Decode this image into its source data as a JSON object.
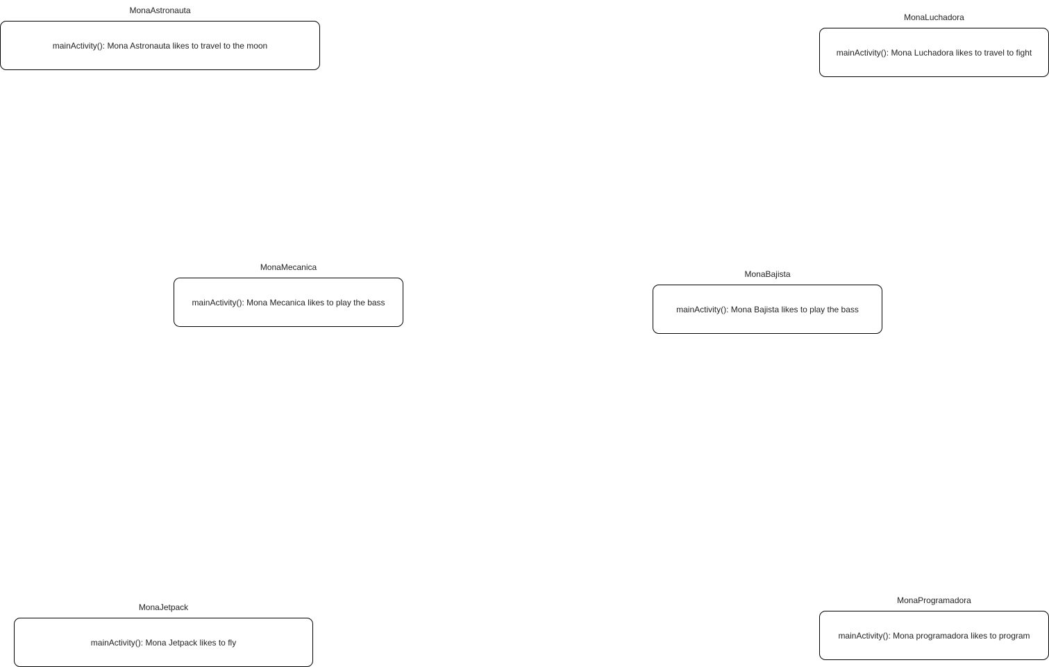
{
  "nodes": {
    "astronauta": {
      "title": "MonaAstronauta",
      "method": "mainActivity(): Mona Astronauta likes to travel to the moon"
    },
    "luchadora": {
      "title": "MonaLuchadora",
      "method": "mainActivity(): Mona Luchadora likes to travel to fight"
    },
    "mecanica": {
      "title": "MonaMecanica",
      "method": "mainActivity(): Mona Mecanica likes to play the bass"
    },
    "bajista": {
      "title": "MonaBajista",
      "method": "mainActivity(): Mona Bajista likes to play the bass"
    },
    "jetpack": {
      "title": "MonaJetpack",
      "method": "mainActivity(): Mona Jetpack likes to fly"
    },
    "programadora": {
      "title": "MonaProgramadora",
      "method": "mainActivity(): Mona programadora likes to program"
    }
  }
}
